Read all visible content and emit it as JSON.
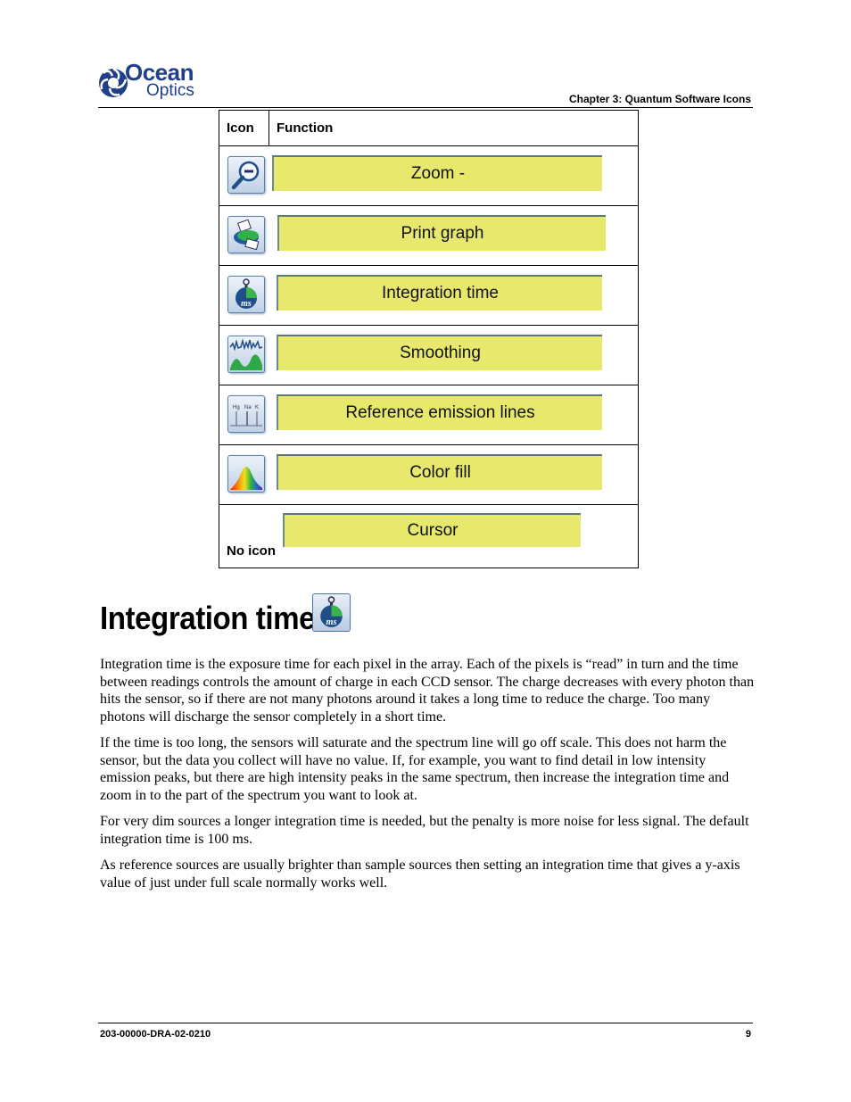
{
  "header": {
    "logo_line1": "Ocean",
    "logo_line2": "Optics",
    "chapter": "Chapter 3: Quantum Software Icons"
  },
  "table": {
    "columns": [
      "Icon",
      "Function"
    ],
    "rows": [
      {
        "icon": "zoom-out-icon",
        "function": "Zoom -"
      },
      {
        "icon": "print-icon",
        "function": "Print graph"
      },
      {
        "icon": "stopwatch-ms-icon",
        "function": "Integration time"
      },
      {
        "icon": "smoothing-icon",
        "function": "Smoothing"
      },
      {
        "icon": "emission-lines-icon",
        "function": "Reference emission lines",
        "icon_labels": [
          "Hg",
          "Na",
          "K"
        ]
      },
      {
        "icon": "color-fill-icon",
        "function": "Color fill"
      },
      {
        "icon": null,
        "icon_text": "No icon",
        "function": "Cursor"
      }
    ]
  },
  "section": {
    "title": "Integration time",
    "title_icon": "stopwatch-ms-icon",
    "paragraphs": [
      "Integration time is the exposure time for each pixel in the array. Each of the pixels is “read” in turn and the time between readings controls the amount of charge in each CCD sensor. The charge decreases with every photon than hits the sensor, so if there are not many photons around it takes a long time to reduce the charge. Too many photons will discharge the sensor completely in a short time.",
      "If the time is too long, the sensors will saturate and the spectrum line will go off scale. This does not harm the sensor, but the data you collect will have no value. If, for example, you want to find detail in low intensity emission peaks, but there are high intensity peaks in the same spectrum, then increase the integration time and zoom in to the part of the spectrum you want to look at.",
      "For very dim sources a longer integration time is needed, but the penalty is more noise for less signal. The default integration time is 100 ms.",
      "As reference sources are usually brighter than sample sources then setting an integration time that gives a y-axis value of just under full scale normally works well."
    ]
  },
  "footer": {
    "doc_id": "203-00000-DRA-02-0210",
    "page": "9"
  },
  "colors": {
    "brand_blue": "#1f3f8a",
    "label_yellow": "#e8e86c",
    "icon_border": "#5c7fa6"
  }
}
